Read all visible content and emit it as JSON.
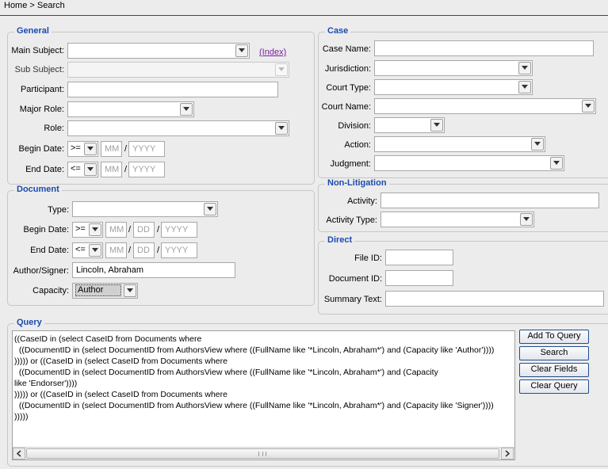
{
  "breadcrumb": "Home > Search",
  "general": {
    "legend": "General",
    "main_subject_label": "Main Subject:",
    "index_link": "(Index)",
    "sub_subject_label": "Sub Subject:",
    "participant_label": "Participant:",
    "major_role_label": "Major Role:",
    "role_label": "Role:",
    "begin_date_label": "Begin Date:",
    "begin_op": ">=",
    "end_date_label": "End Date:",
    "end_op": "<=",
    "mm_placeholder": "MM",
    "yyyy_placeholder": "YYYY"
  },
  "document": {
    "legend": "Document",
    "type_label": "Type:",
    "begin_date_label": "Begin Date:",
    "begin_op": ">=",
    "end_date_label": "End Date:",
    "end_op": "<=",
    "mm_placeholder": "MM",
    "dd_placeholder": "DD",
    "yyyy_placeholder": "YYYY",
    "author_signer_label": "Author/Signer:",
    "author_signer_value": "Lincoln, Abraham",
    "capacity_label": "Capacity:",
    "capacity_value": "Author"
  },
  "case": {
    "legend": "Case",
    "case_name_label": "Case Name:",
    "jurisdiction_label": "Jurisdiction:",
    "court_type_label": "Court Type:",
    "court_name_label": "Court Name:",
    "division_label": "Division:",
    "action_label": "Action:",
    "judgment_label": "Judgment:"
  },
  "non_litigation": {
    "legend": "Non-Litigation",
    "activity_label": "Activity:",
    "activity_type_label": "Activity Type:"
  },
  "direct": {
    "legend": "Direct",
    "file_id_label": "File ID:",
    "document_id_label": "Document ID:",
    "summary_text_label": "Summary Text:"
  },
  "query": {
    "legend": "Query",
    "text": "((CaseID in (select CaseID from Documents where\n  ((DocumentID in (select DocumentID from AuthorsView where ((FullName like '*Lincoln, Abraham*') and (Capacity like 'Author'))))\n))))) or ((CaseID in (select CaseID from Documents where\n  ((DocumentID in (select DocumentID from AuthorsView where ((FullName like '*Lincoln, Abraham*') and (Capacity\nlike 'Endorser'))))\n))))) or ((CaseID in (select CaseID from Documents where\n  ((DocumentID in (select DocumentID from AuthorsView where ((FullName like '*Lincoln, Abraham*') and (Capacity like 'Signer'))))\n)))))",
    "buttons": {
      "add_to_query": "Add To Query",
      "search": "Search",
      "clear_fields": "Clear Fields",
      "clear_query": "Clear Query"
    }
  }
}
